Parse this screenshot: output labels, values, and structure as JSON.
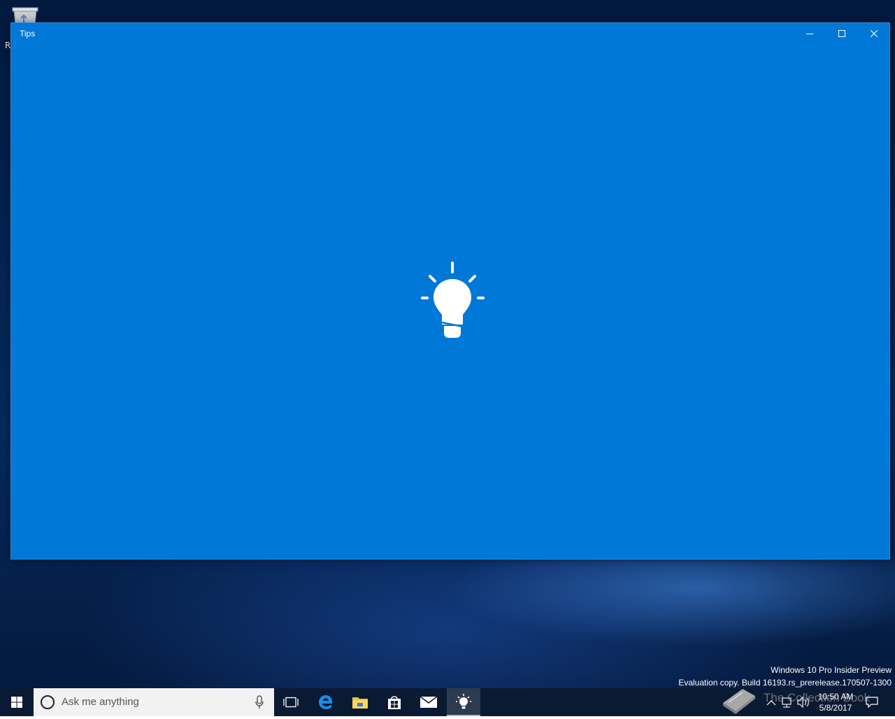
{
  "desktop": {
    "recycle_bin_label": "R"
  },
  "window": {
    "title": "Tips",
    "controls": {
      "minimize": "minimize-icon",
      "maximize": "maximize-icon",
      "close": "close-icon"
    },
    "splash_icon": "lightbulb-icon",
    "background_color": "#0078d7"
  },
  "watermark": {
    "line1": "Windows 10 Pro Insider Preview",
    "line2": "Evaluation copy. Build 16193.rs_prerelease.170507-1300"
  },
  "taskbar": {
    "search_placeholder": "Ask me anything",
    "pinned": [
      "start-icon",
      "task-view-icon",
      "edge-icon",
      "file-explorer-icon",
      "store-icon",
      "mail-icon",
      "tips-icon"
    ],
    "overlay_text": "The Collection Book",
    "clock": {
      "time": "10:50 AM",
      "date": "5/8/2017"
    }
  }
}
